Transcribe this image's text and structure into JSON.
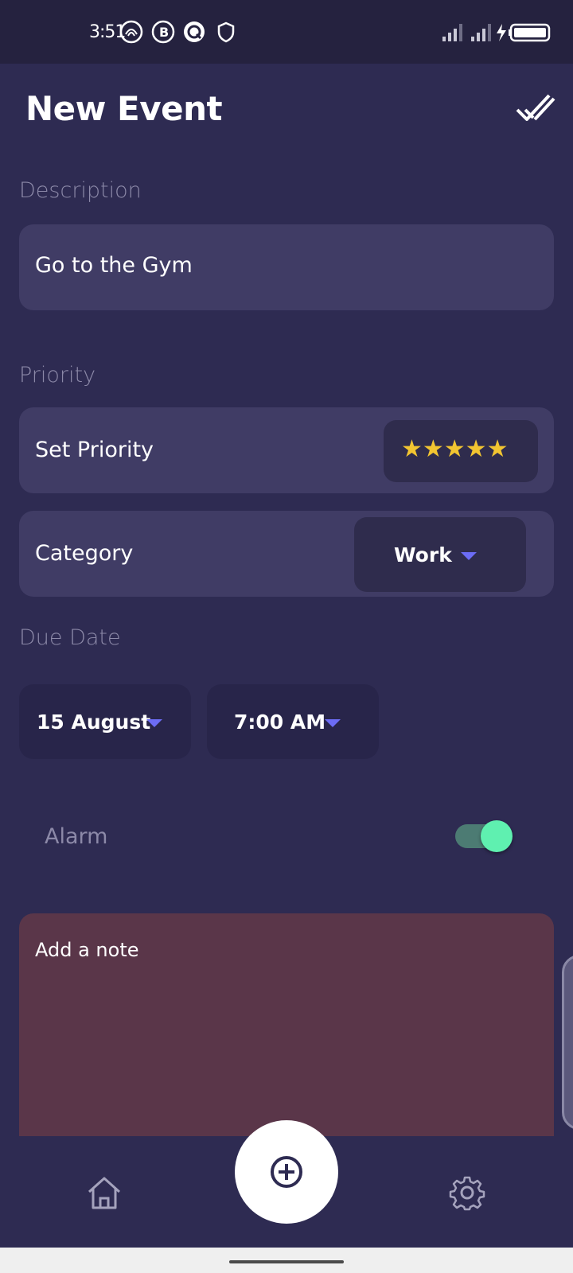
{
  "status_bar": {
    "time": "3:51",
    "icons_left": [
      "phoenix-icon",
      "b-app-icon",
      "q-app-icon",
      "shield-icon"
    ],
    "icons_right": [
      "signal-icon",
      "signal-icon",
      "charging-icon",
      "battery-icon"
    ]
  },
  "header": {
    "title": "New Event",
    "confirm_icon": "double-check-icon"
  },
  "description": {
    "label": "Description",
    "value": "Go to the Gym"
  },
  "priority": {
    "label": "Priority",
    "set_priority_label": "Set Priority",
    "stars": "★★★★★",
    "rating": 5,
    "rating_max": 5,
    "category_label": "Category",
    "category_value": "Work"
  },
  "due_date": {
    "label": "Due Date",
    "date": "15 August",
    "time": "7:00 AM"
  },
  "alarm": {
    "label": "Alarm",
    "enabled": true
  },
  "note": {
    "placeholder": "Add a note"
  },
  "bottom_nav": {
    "items": [
      "home-icon",
      "add-icon",
      "settings-icon"
    ]
  },
  "colors": {
    "background": "#2e2b52",
    "card": "#403c65",
    "accent_caret": "#6c6cf5",
    "toggle_on": "#5ff0b0",
    "note_bg": "#5a3649",
    "star": "#f2c531"
  }
}
